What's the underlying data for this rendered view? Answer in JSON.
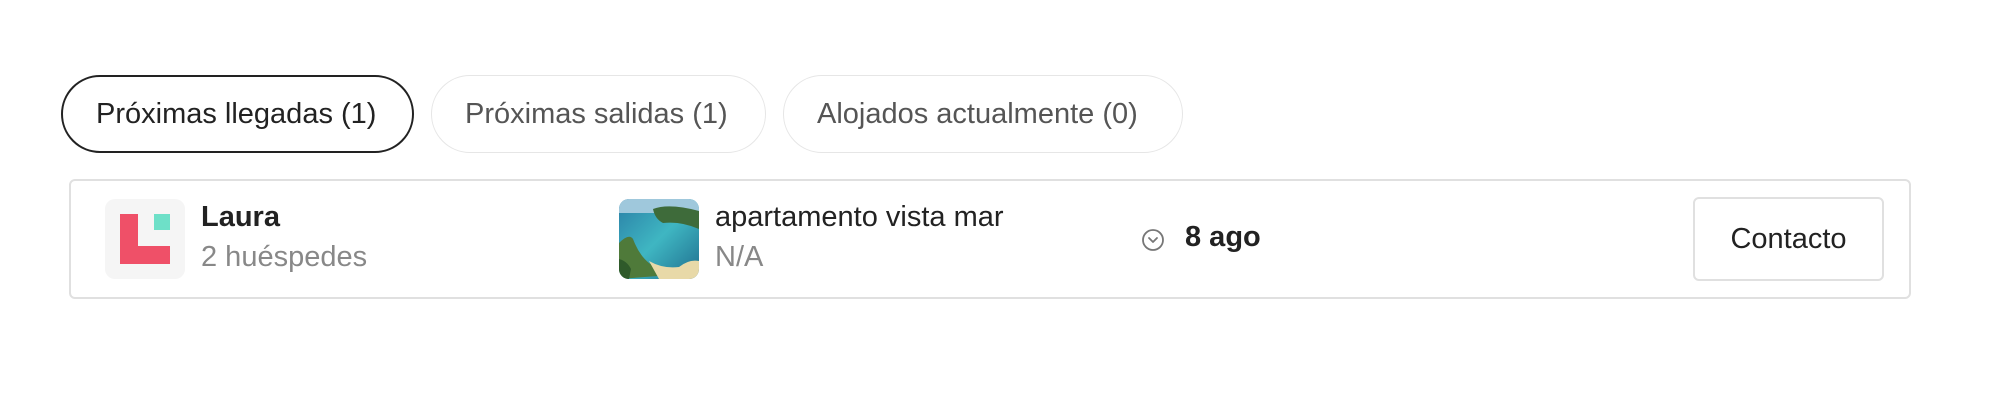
{
  "tabs": [
    {
      "label": "Próximas llegadas (1)",
      "active": true
    },
    {
      "label": "Próximas salidas (1)",
      "active": false
    },
    {
      "label": "Alojados actualmente (0)",
      "active": false
    }
  ],
  "reservation": {
    "guest_name": "Laura",
    "guest_count": "2 huéspedes",
    "property_name": "apartamento vista mar",
    "property_sub": "N/A",
    "date": "8 ago",
    "contact_label": "Contacto"
  },
  "icons": {
    "logo": "brand-logo-icon",
    "property": "property-photo",
    "date": "clock-icon"
  },
  "colors": {
    "brand_red": "#ef5068",
    "brand_teal": "#6ee0c8",
    "active_border": "#222222"
  }
}
